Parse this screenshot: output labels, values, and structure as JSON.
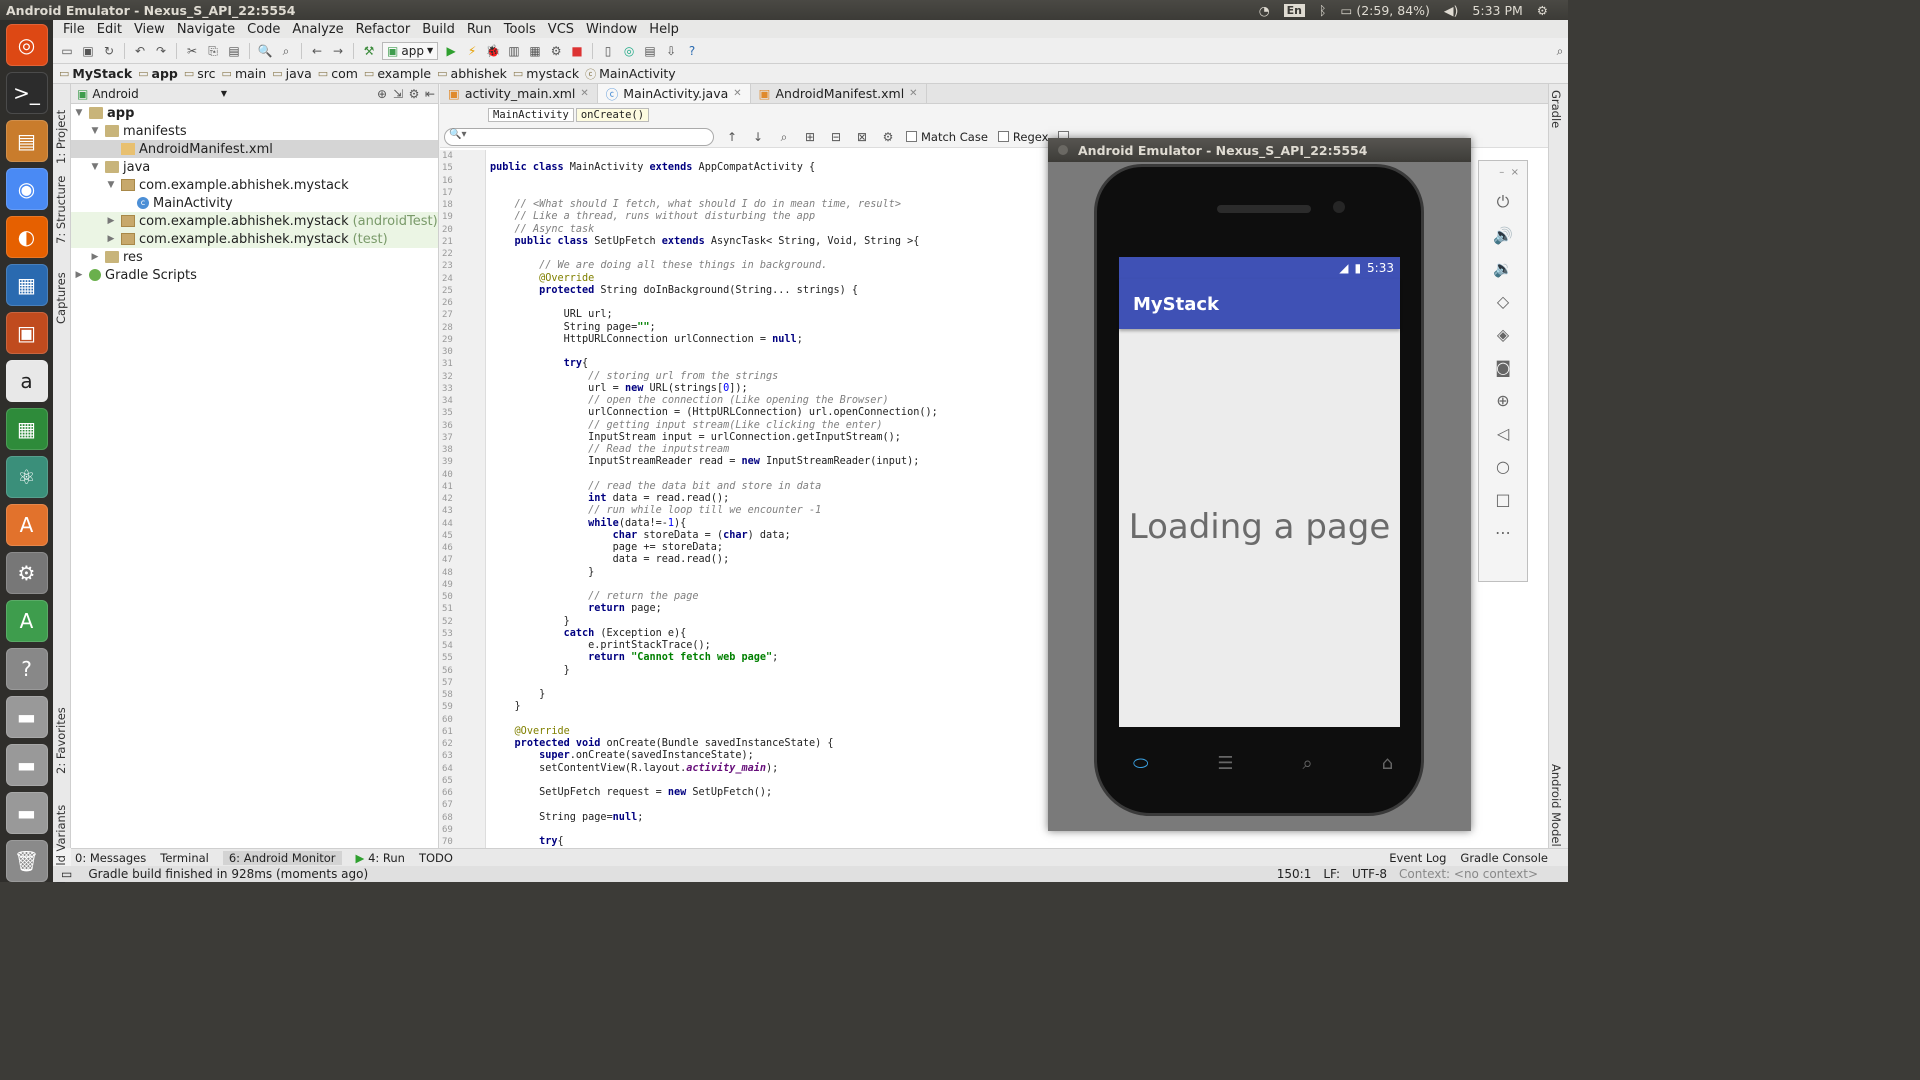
{
  "topbar": {
    "title": "Android Emulator - Nexus_S_API_22:5554",
    "lang": "En",
    "battery": "(2:59, 84%)",
    "time": "5:33 PM"
  },
  "menu": [
    "File",
    "Edit",
    "View",
    "Navigate",
    "Code",
    "Analyze",
    "Refactor",
    "Build",
    "Run",
    "Tools",
    "VCS",
    "Window",
    "Help"
  ],
  "toolbar": {
    "run_config": "app"
  },
  "nav": [
    "MyStack",
    "app",
    "src",
    "main",
    "java",
    "com",
    "example",
    "abhishek",
    "mystack",
    "MainActivity"
  ],
  "left_tabs": {
    "project": "1: Project",
    "structure": "7: Structure",
    "captures": "Captures",
    "favorites": "2: Favorites",
    "build_variants": "Build Variants"
  },
  "project": {
    "view": "Android",
    "tree": [
      {
        "label": "app",
        "indent": 0
      },
      {
        "label": "manifests",
        "indent": 1
      },
      {
        "label": "AndroidManifest.xml",
        "indent": 2
      },
      {
        "label": "java",
        "indent": 1
      },
      {
        "label": "com.example.abhishek.mystack",
        "indent": 2
      },
      {
        "label": "MainActivity",
        "indent": 3
      },
      {
        "label": "com.example.abhishek.mystack",
        "suffix": "(androidTest)",
        "indent": 2
      },
      {
        "label": "com.example.abhishek.mystack",
        "suffix": "(test)",
        "indent": 2
      },
      {
        "label": "res",
        "indent": 1
      },
      {
        "label": "Gradle Scripts",
        "indent": 0
      }
    ]
  },
  "tabs": [
    "activity_main.xml",
    "MainActivity.java",
    "AndroidManifest.xml"
  ],
  "breadcrumb": {
    "cls": "MainActivity",
    "method": "onCreate()"
  },
  "search": {
    "match_case": "Match Case",
    "regex": "Regex"
  },
  "code_first_line": 14,
  "bottom_tools": {
    "messages": "0: Messages",
    "terminal": "Terminal",
    "monitor": "6: Android Monitor",
    "run": "4: Run",
    "todo": "TODO",
    "event_log": "Event Log",
    "gradle_console": "Gradle Console"
  },
  "status": {
    "message": "Gradle build finished in 928ms (moments ago)",
    "position": "150:1",
    "lf": "LF:",
    "encoding": "UTF-8",
    "context": "Context: <no context>"
  },
  "right_tabs": {
    "gradle": "Gradle",
    "android_model": "Android Model"
  },
  "emulator": {
    "title": "Android Emulator - Nexus_S_API_22:5554",
    "status_time": "5:33",
    "app_title": "MyStack",
    "content_text": "Loading a page"
  }
}
